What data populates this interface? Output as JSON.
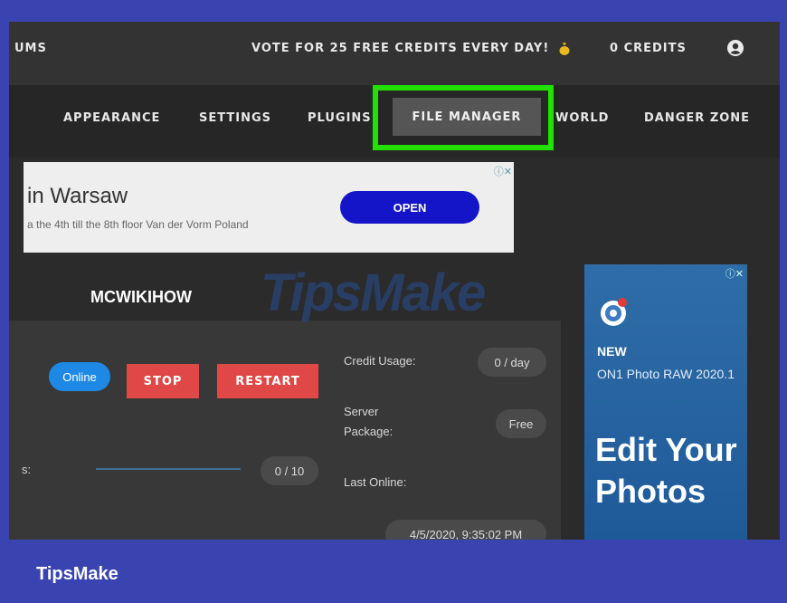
{
  "topbar": {
    "forums_partial": "UMS",
    "vote_text": "VOTE FOR 25 FREE CREDITS EVERY DAY!",
    "credits": "0 CREDITS"
  },
  "nav": {
    "items": [
      "APPEARANCE",
      "SETTINGS",
      "PLUGINS",
      "FILE MANAGER",
      "WORLD",
      "DANGER ZONE"
    ]
  },
  "ad_banner": {
    "title": "in Warsaw",
    "subtitle": "a the 4th till the 8th floor Van der Vorm Poland",
    "button": "OPEN"
  },
  "server": {
    "name": "MCWIKIHOW",
    "status": "Online",
    "stop_label": "STOP",
    "restart_label": "RESTART",
    "players_label_partial": "s:",
    "players_value": "0 / 10",
    "credit_usage_label": "Credit Usage:",
    "credit_usage_value": "0 / day",
    "package_label": "Server Package:",
    "package_value": "Free",
    "last_online_label": "Last Online:",
    "last_online_value": "4/5/2020, 9:35:02 PM"
  },
  "side_ad": {
    "new_label": "NEW",
    "product": "ON1 Photo RAW 2020.1",
    "headline": "Edit Your Photos"
  },
  "watermark": "TipsMake",
  "footer": "TipsMake",
  "colors": {
    "highlight": "#23e000",
    "online": "#1e88e5",
    "danger": "#e04848",
    "frame_bg": "#3a44b0"
  }
}
